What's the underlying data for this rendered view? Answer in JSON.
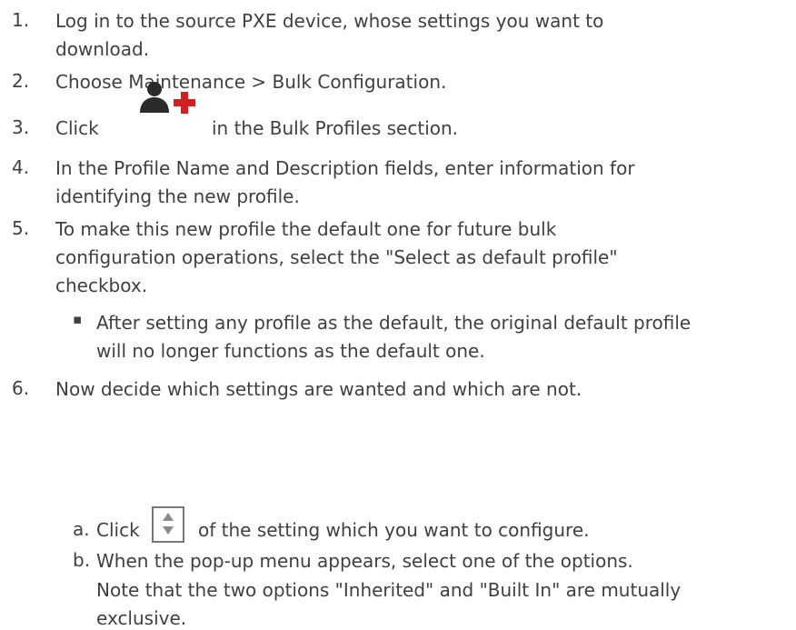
{
  "steps": [
    {
      "num": "1.",
      "lines": [
        "Log in to the source PXE device, whose settings you want to",
        "download."
      ]
    },
    {
      "num": "2.",
      "lines": [
        "Choose Maintenance > Bulk Configuration."
      ]
    },
    {
      "num": "3.",
      "before": "Click",
      "after": "in the Bulk Profiles section.",
      "icon": "user-add-icon"
    },
    {
      "num": "4.",
      "lines": [
        "In the Profile Name and Description fields, enter information for",
        "identifying the new profile."
      ]
    },
    {
      "num": "5.",
      "lines": [
        "To make this new profile the default one for future bulk",
        "configuration operations, select the \"Select as default profile\"",
        "checkbox."
      ]
    },
    {
      "bullet": "▪",
      "lines": [
        "After setting any profile as the default, the original default profile",
        "will no longer functions as the default one."
      ]
    },
    {
      "num": "6.",
      "lines": [
        "Now decide which settings are wanted and which are not."
      ]
    },
    {
      "num": "a.",
      "before": "Click",
      "after": "of the setting which you want to configure.",
      "icon": "sort-arrows-icon"
    },
    {
      "num": "b.",
      "lines": [
        "When the pop-up menu appears, select one of the options."
      ]
    },
    {
      "note_lines": [
        "Note that the two options \"Inherited\" and \"Built In\" are mutually",
        "exclusive."
      ]
    }
  ],
  "colors": {
    "text": "#404040",
    "icon_dark": "#2b2b2b",
    "icon_red": "#d21f1f"
  }
}
